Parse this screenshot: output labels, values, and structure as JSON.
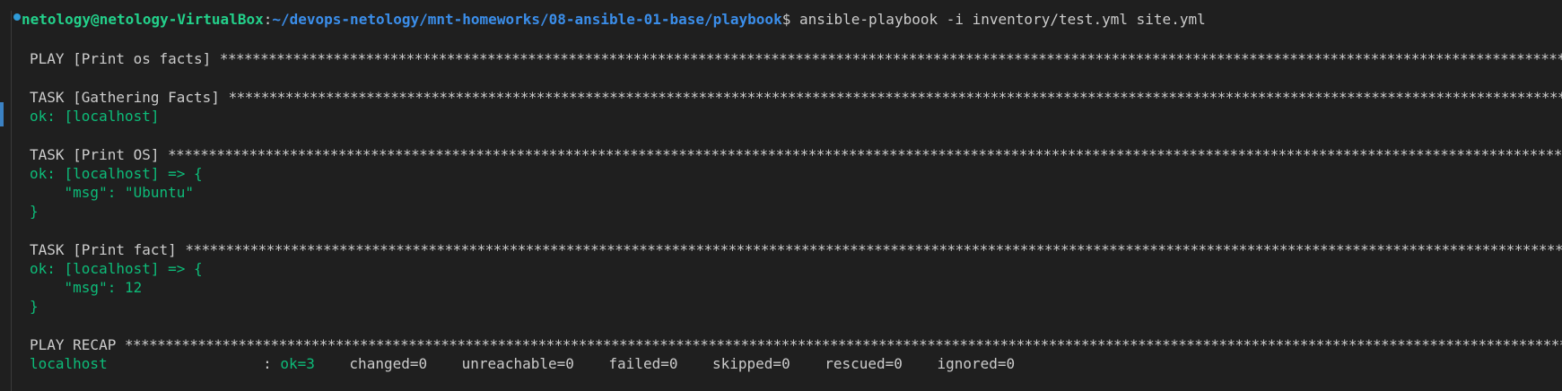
{
  "prompt": {
    "user_host": "netology@netology-VirtualBox",
    "separator": ":",
    "path": "~/devops-netology/mnt-homeworks/08-ansible-01-base/playbook",
    "symbol": "$",
    "command": " ansible-playbook -i inventory/test.yml site.yml"
  },
  "output": {
    "play_header": "PLAY [Print os facts] ",
    "task1_header": "TASK [Gathering Facts] ",
    "task1_result": "ok: [localhost]",
    "task2_header": "TASK [Print OS] ",
    "task2_result": "ok: [localhost] => {",
    "task2_msg": "    \"msg\": \"Ubuntu\"",
    "task2_close": "}",
    "task3_header": "TASK [Print fact] ",
    "task3_result": "ok: [localhost] => {",
    "task3_msg": "    \"msg\": 12",
    "task3_close": "}",
    "recap_header": "PLAY RECAP ",
    "recap_host": "localhost",
    "recap_sep": "                  : ",
    "recap_ok": "ok=3",
    "recap_rest": "    changed=0    unreachable=0    failed=0    skipped=0    rescued=0    ignored=0",
    "stars": "************************************************************************************************************************************************************************************************************"
  },
  "colors": {
    "background": "#1f1f1f",
    "text": "#cccccc",
    "green": "#0dbc79",
    "user": "#23d18b",
    "path": "#3b8eea"
  }
}
